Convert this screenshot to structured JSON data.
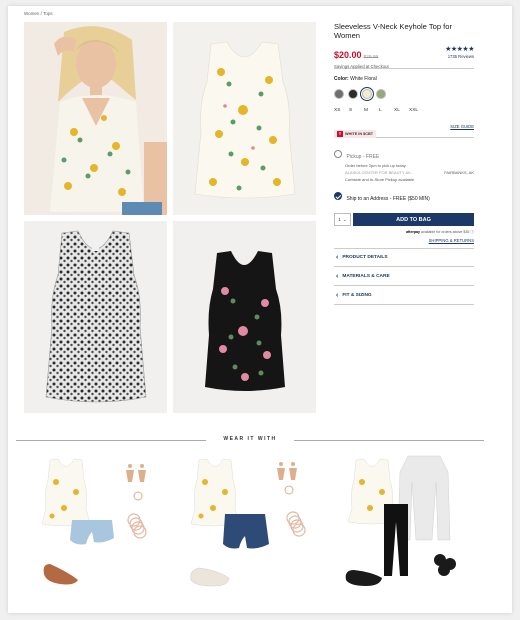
{
  "breadcrumb": "Women / Tops",
  "product": {
    "title": "Sleeveless V-Neck Keyhole Top for Women",
    "price": "$20.00",
    "original_price": "$29.99",
    "savings": "Savings Applied at Checkout",
    "stars": "★★★★★",
    "reviews": "1735 Reviews",
    "color_label": "Color:",
    "color_value": "White Floral",
    "sizes": [
      "XS",
      "S",
      "M",
      "L",
      "XL",
      "XXL"
    ],
    "promo_text": "WHITE IN $CBT",
    "size_guide": "SIZE GUIDE",
    "pickup_label": "Pickup - FREE",
    "pickup_note": "Order before 2pm to pick up today",
    "store_name": "ALASKA CENTER FOR BEAUTY AV...",
    "store_city": "FAIRBANKS, AK",
    "curbside_note": "Curbside and In-Store Pickup available",
    "ship_label": "Ship to an Address - FREE ($50 MIN)",
    "qty": "1",
    "add_to_bag": "ADD TO BAG",
    "afterpay_brand": "afterpay",
    "afterpay_note": "available for orders above $35",
    "shipping_returns": "SHIPPING & RETURNS",
    "accordions": [
      "PRODUCT DETAILS",
      "MATERIALS & CARE",
      "FIT & SIZING"
    ]
  },
  "swatch_colors": [
    "#6f6f6f",
    "#2b2b2b",
    "#f4efc8",
    "#9aa77c"
  ],
  "wear_it_with": "WEAR IT WITH",
  "colors": {
    "navy": "#1b3866",
    "price_red": "#c8102e"
  }
}
